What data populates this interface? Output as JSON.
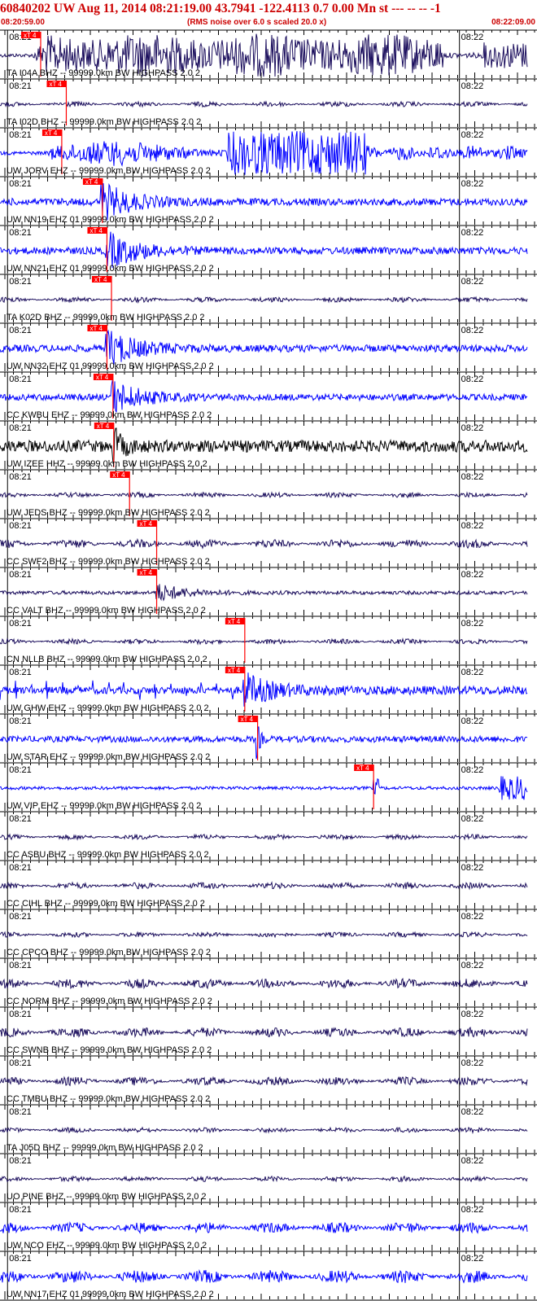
{
  "header": {
    "title": "60840202 UW Aug 11, 2014 08:21:19.00   43.7941 -122.4113  0.7 0.00 Mn st --- -- --  -1",
    "start_time": "08:20:59.00",
    "rms_note": "(RMS noise over 6.0 s scaled 20.0 x)",
    "end_time": "08:22:09.00"
  },
  "colors": {
    "pick": "#ff0000",
    "dark_trace": "#1a0d5c",
    "blue_trace": "#0000ff",
    "black_trace": "#000000",
    "header_text": "#cc0000"
  },
  "chart_data": {
    "type": "line",
    "title": "60840202 UW Aug 11, 2014 08:21:19.00   43.7941 -122.4113  0.7 0.00 Mn st --- -- --  -1",
    "x_range": [
      "08:20:59.00",
      "08:22:09.00"
    ],
    "x_tick_labels": [
      "08:21",
      "08:22"
    ],
    "pick_label": "xT 4",
    "series": [
      {
        "name": "TA.I04A.BHZ.--",
        "label": "TA I04A BHZ -- 99999.0km BW  HIGHPASS  2.0  2",
        "color": "dark",
        "pick_time": "08:21:04.4",
        "amp": 1.0,
        "env": "emerg"
      },
      {
        "name": "TA.I02D.BHZ.--",
        "label": "TA I02D BHZ -- 99999.0km BW  HIGHPASS  2.0  2",
        "color": "dark",
        "pick_time": "08:21:07.8",
        "amp": 0.12,
        "env": "noise"
      },
      {
        "name": "UW.JORV.EHZ.--",
        "label": "UW JORV EHZ -- 99999.0km BW  HIGHPASS  2.0  2",
        "color": "blue",
        "pick_time": "08:21:07.2",
        "amp": 1.0,
        "env": "jorv"
      },
      {
        "name": "UW.NN19.EHZ.01",
        "label": "UW NN19 EHZ 01 99999.0km BW  HIGHPASS  2.0  2",
        "color": "blue",
        "pick_time": "08:21:12.6",
        "amp": 0.9,
        "env": "event"
      },
      {
        "name": "UW.NN21.EHZ.01",
        "label": "UW NN21 EHZ 01 99999.0km BW  HIGHPASS  2.0  2",
        "color": "blue",
        "pick_time": "08:21:13.2",
        "amp": 0.9,
        "env": "event"
      },
      {
        "name": "TA.K02D.BHZ.--",
        "label": "TA K02D BHZ -- 99999.0km BW  HIGHPASS  2.0  2",
        "color": "dark",
        "pick_time": "08:21:13.8",
        "amp": 0.12,
        "env": "noise"
      },
      {
        "name": "UW.NN32.EHZ.01",
        "label": "UW NN32 EHZ 01 99999.0km BW  HIGHPASS  2.0  2",
        "color": "blue",
        "pick_time": "08:21:13.2",
        "amp": 0.9,
        "env": "event"
      },
      {
        "name": "CC.KWBU.EHZ.--",
        "label": "CC KWBU EHZ -- 99999.0km BW  HIGHPASS  2.0  2",
        "color": "blue",
        "pick_time": "08:21:14.0",
        "amp": 0.8,
        "env": "event"
      },
      {
        "name": "UW.IZEE.HHZ.--",
        "label": "UW IZEE HHZ -- 99999.0km BW  HIGHPASS  2.0  2",
        "color": "black",
        "pick_time": "08:21:14.1",
        "amp": 0.9,
        "env": "spike"
      },
      {
        "name": "UW.JEDS.BHZ.--",
        "label": "UW JEDS BHZ -- 99999.0km BW  HIGHPASS  2.0  2",
        "color": "dark",
        "pick_time": "08:21:16.2",
        "amp": 0.12,
        "env": "noise"
      },
      {
        "name": "CC.SWF2.BHZ.--",
        "label": "CC SWF2 BHZ -- 99999.0km BW  HIGHPASS  2.0  2",
        "color": "dark",
        "pick_time": "08:21:19.8",
        "amp": 0.2,
        "env": "noise"
      },
      {
        "name": "CC.VALT.BHZ.--",
        "label": "CC VALT BHZ -- 99999.0km BW  HIGHPASS  2.0  2",
        "color": "dark",
        "pick_time": "08:21:19.8",
        "amp": 0.45,
        "env": "event"
      },
      {
        "name": "CN.NLLB.BHZ.--",
        "label": "CN NLLB BHZ -- 99999.0km BW  HIGHPASS  2.0  2",
        "color": "dark",
        "pick_time": "08:21:31.5",
        "amp": 0.12,
        "env": "noise"
      },
      {
        "name": "UW.GHW.EHZ.--",
        "label": "UW GHW EHZ -- 99999.0km BW  HIGHPASS  2.0  2",
        "color": "blue",
        "pick_time": "08:21:31.5",
        "amp": 0.8,
        "env": "spiky"
      },
      {
        "name": "UW.STAR.EHZ.--",
        "label": "UW STAR EHZ -- 99999.0km BW  HIGHPASS  2.0  2",
        "color": "blue",
        "pick_time": "08:21:33.2",
        "amp": 0.7,
        "env": "star"
      },
      {
        "name": "UW.VIP.EHZ.--",
        "label": "UW VIP EHZ -- 99999.0km BW  HIGHPASS  2.0  2",
        "color": "blue",
        "pick_time": "08:21:48.6",
        "amp": 0.6,
        "env": "vip"
      },
      {
        "name": "CC.ASBU.BHZ.--",
        "label": "CC ASBU BHZ -- 99999.0km BW  HIGHPASS  2.0  2",
        "color": "dark",
        "pick_time": null,
        "amp": 0.12,
        "env": "noise"
      },
      {
        "name": "CC.CIHL.BHZ.--",
        "label": "CC CIHL BHZ -- 99999.0km BW  HIGHPASS  2.0  2",
        "color": "dark",
        "pick_time": null,
        "amp": 0.15,
        "env": "noise"
      },
      {
        "name": "CC.CPCO.BHZ.--",
        "label": "CC CPCO BHZ -- 99999.0km BW  HIGHPASS  2.0  2",
        "color": "dark",
        "pick_time": null,
        "amp": 0.12,
        "env": "noise"
      },
      {
        "name": "CC.NORM.BHZ.--",
        "label": "CC NORM BHZ -- 99999.0km BW  HIGHPASS  2.0  2",
        "color": "dark",
        "pick_time": null,
        "amp": 0.22,
        "env": "noise"
      },
      {
        "name": "CC.SWNB.BHZ.--",
        "label": "CC SWNB BHZ -- 99999.0km BW  HIGHPASS  2.0  2",
        "color": "dark",
        "pick_time": null,
        "amp": 0.22,
        "env": "noise"
      },
      {
        "name": "CC.TMBU.BHZ.--",
        "label": "CC TMBU BHZ -- 99999.0km BW  HIGHPASS  2.0  2",
        "color": "dark",
        "pick_time": null,
        "amp": 0.2,
        "env": "noise"
      },
      {
        "name": "TA.J05D.BHZ.--",
        "label": "TA J05D BHZ -- 99999.0km BW  HIGHPASS  2.0  2",
        "color": "dark",
        "pick_time": null,
        "amp": 0.12,
        "env": "noise"
      },
      {
        "name": "UO.PINE.BHZ.--",
        "label": "UO PINE BHZ -- 99999.0km BW  HIGHPASS  2.0  2",
        "color": "dark",
        "pick_time": null,
        "amp": 0.12,
        "env": "noise"
      },
      {
        "name": "UW.NCO.EHZ.--",
        "label": "UW NCO EHZ -- 99999.0km BW  HIGHPASS  2.0  2",
        "color": "blue",
        "pick_time": null,
        "amp": 0.25,
        "env": "noise"
      },
      {
        "name": "UW.NN17.EHZ.01",
        "label": "UW NN17 EHZ 01 99999.0km BW  HIGHPASS  2.0  2",
        "color": "blue",
        "pick_time": null,
        "amp": 0.3,
        "env": "noise"
      }
    ]
  }
}
